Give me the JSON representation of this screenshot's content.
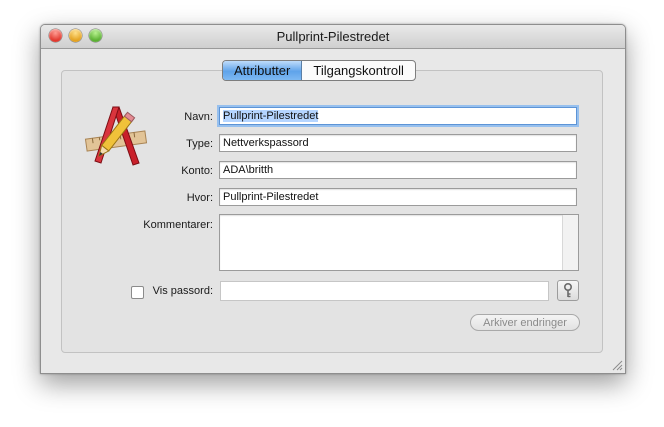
{
  "window": {
    "title": "Pullprint-Pilestredet"
  },
  "tabs": [
    {
      "label": "Attributter",
      "active": true
    },
    {
      "label": "Tilgangskontroll",
      "active": false
    }
  ],
  "form": {
    "name_label": "Navn:",
    "name_value": "Pullprint-Pilestredet",
    "type_label": "Type:",
    "type_value": "Nettverkspassord",
    "account_label": "Konto:",
    "account_value": "ADA\\britth",
    "where_label": "Hvor:",
    "where_value": "Pullprint-Pilestredet",
    "comments_label": "Kommentarer:",
    "comments_value": "",
    "show_password_label": "Vis passord:",
    "show_password_checked": false,
    "password_value": ""
  },
  "buttons": {
    "save_label": "Arkiver endringer"
  },
  "icons": {
    "app": "app-development-icon",
    "key": "key-icon",
    "resize": "resize-grip-icon"
  },
  "colors": {
    "accent": "#5fa3ea",
    "focus_ring": "#97c0ee",
    "selection": "#b5d5ff"
  }
}
